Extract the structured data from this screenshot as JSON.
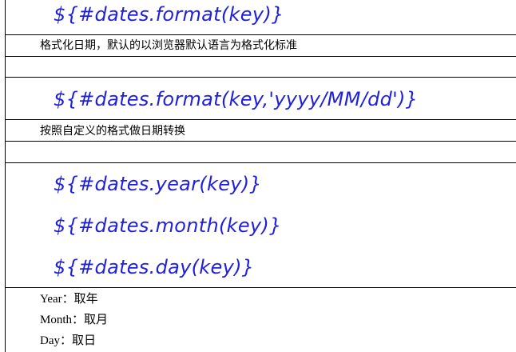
{
  "rows": {
    "code_format": "${#dates.format(key)}",
    "desc_format": "格式化日期，默认的以浏览器默认语言为格式化标准",
    "code_format_pattern": "${#dates.format(key,'yyyy/MM/dd')}",
    "desc_format_pattern": "按照自定义的格式做日期转换",
    "code_year": "${#dates.year(key)}",
    "code_month": "${#dates.month(key)}",
    "code_day": "${#dates.day(key)}",
    "note_year": "Year：取年",
    "note_month": "Month：取月",
    "note_day": "Day：取日"
  },
  "colors": {
    "code": "#1f1fdc",
    "text": "#000000",
    "rule": "#000000"
  }
}
